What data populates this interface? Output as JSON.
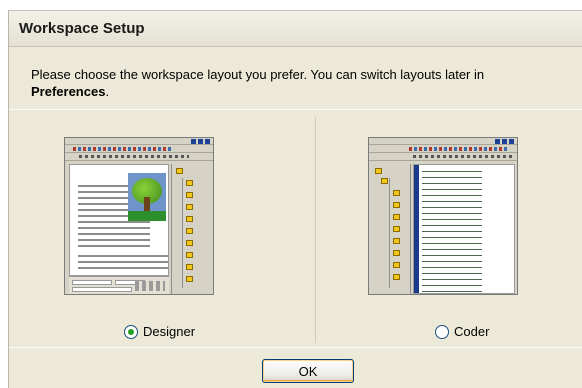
{
  "dialog": {
    "title": "Workspace Setup",
    "intro_text": "Please choose the workspace layout you prefer. You can switch layouts later in",
    "intro_bold": "Preferences",
    "intro_end": "."
  },
  "options": [
    {
      "label": "Designer",
      "selected": true
    },
    {
      "label": "Coder",
      "selected": false
    }
  ],
  "buttons": {
    "ok_label": "OK"
  },
  "colors": {
    "radio_check": "#21a121",
    "button_border": "#003c74",
    "dialog_bg": "#ece9d8"
  },
  "icons": {
    "designer_thumbnail": "designer-layout-icon",
    "coder_thumbnail": "coder-layout-icon"
  }
}
